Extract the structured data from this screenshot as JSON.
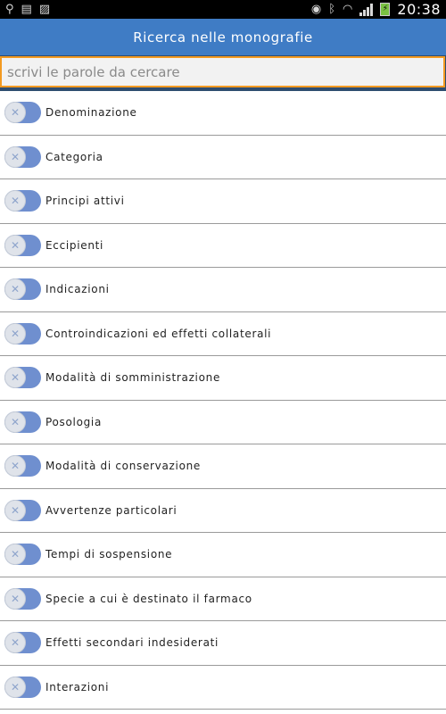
{
  "statusbar": {
    "time": "20:38",
    "icons_left": [
      "usb-icon",
      "sim-card-icon",
      "image-icon"
    ],
    "icons_right": [
      "eye-icon",
      "bluetooth-icon",
      "wifi-icon",
      "signal-icon",
      "battery-charging-icon"
    ]
  },
  "header": {
    "title": "Ricerca nelle monografie"
  },
  "search": {
    "placeholder": "scrivi le parole da cercare",
    "value": ""
  },
  "colors": {
    "header": "#3f7cc5",
    "search_border": "#f39a21",
    "toggle_track": "#6f8fcf"
  },
  "filters": [
    {
      "label": "Denominazione",
      "enabled": false
    },
    {
      "label": "Categoria",
      "enabled": false
    },
    {
      "label": "Principi attivi",
      "enabled": false
    },
    {
      "label": "Eccipienti",
      "enabled": false
    },
    {
      "label": "Indicazioni",
      "enabled": false
    },
    {
      "label": "Controindicazioni ed effetti collaterali",
      "enabled": false
    },
    {
      "label": "Modalità di somministrazione",
      "enabled": false
    },
    {
      "label": "Posologia",
      "enabled": false
    },
    {
      "label": "Modalità di conservazione",
      "enabled": false
    },
    {
      "label": "Avvertenze particolari",
      "enabled": false
    },
    {
      "label": "Tempi di sospensione",
      "enabled": false
    },
    {
      "label": "Specie a cui è destinato il farmaco",
      "enabled": false
    },
    {
      "label": "Effetti secondari indesiderati",
      "enabled": false
    },
    {
      "label": "Interazioni",
      "enabled": false
    }
  ]
}
